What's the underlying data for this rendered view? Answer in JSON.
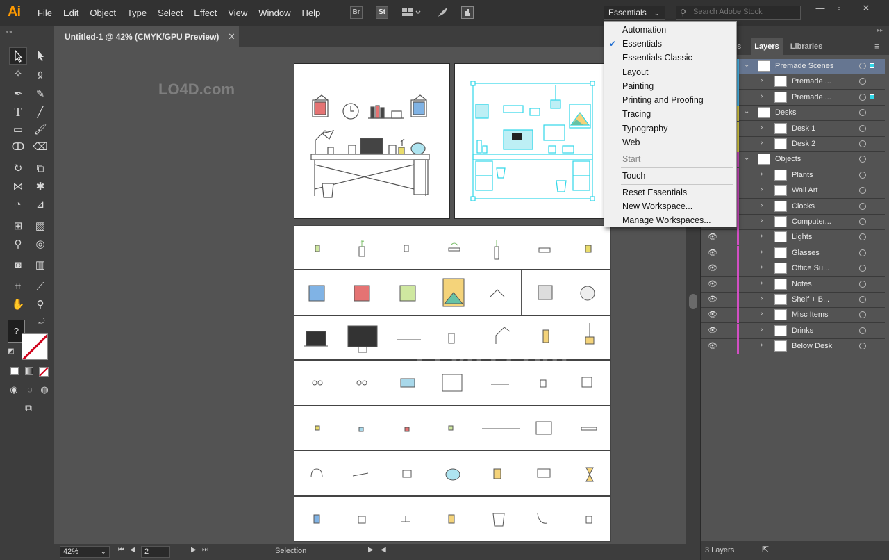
{
  "app": {
    "logo": "Ai"
  },
  "menubar": {
    "items": [
      "File",
      "Edit",
      "Object",
      "Type",
      "Select",
      "Effect",
      "View",
      "Window",
      "Help"
    ],
    "icons": {
      "bridge": "Br",
      "stock": "St"
    }
  },
  "workspace": {
    "current": "Essentials"
  },
  "search": {
    "placeholder": "Search Adobe Stock"
  },
  "document": {
    "tab_title": "Untitled-1 @ 42% (CMYK/GPU Preview)"
  },
  "status": {
    "zoom": "42%",
    "artboard": "2",
    "tool": "Selection"
  },
  "workspace_menu": {
    "items": [
      "Automation",
      "Essentials",
      "Essentials Classic",
      "Layout",
      "Painting",
      "Printing and Proofing",
      "Tracing",
      "Typography",
      "Web"
    ],
    "start_label": "Start",
    "touch_label": "Touch",
    "actions": [
      "Reset Essentials",
      "New Workspace...",
      "Manage Workspaces..."
    ]
  },
  "layers_panel": {
    "tabs": [
      "es",
      "Layers",
      "Libraries"
    ],
    "footer": "3 Layers",
    "rows": [
      {
        "name": "Premade Scenes",
        "color": "#4fc3f7"
      },
      {
        "name": "Premade ...",
        "color": "#4fc3f7"
      },
      {
        "name": "Premade ...",
        "color": "#4fc3f7"
      },
      {
        "name": "Desks",
        "color": "#e6d84a"
      },
      {
        "name": "Desk 1",
        "color": "#e6d84a"
      },
      {
        "name": "Desk 2",
        "color": "#e6d84a"
      },
      {
        "name": "Objects",
        "color": "#d24fc4"
      },
      {
        "name": "Plants",
        "color": "#d24fc4"
      },
      {
        "name": "Wall Art",
        "color": "#d24fc4"
      },
      {
        "name": "Clocks",
        "color": "#d24fc4"
      },
      {
        "name": "Computer...",
        "color": "#d24fc4"
      },
      {
        "name": "Lights",
        "color": "#d24fc4"
      },
      {
        "name": "Glasses",
        "color": "#d24fc4"
      },
      {
        "name": "Office Su...",
        "color": "#d24fc4"
      },
      {
        "name": "Notes",
        "color": "#d24fc4"
      },
      {
        "name": "Shelf + B...",
        "color": "#d24fc4"
      },
      {
        "name": "Misc Items",
        "color": "#d24fc4"
      },
      {
        "name": "Drinks",
        "color": "#d24fc4"
      },
      {
        "name": "Below Desk",
        "color": "#d24fc4"
      }
    ]
  },
  "watermark": {
    "text": "LO4D.com"
  },
  "colors": {
    "accent": "#ff9a00",
    "selection": "#31d7e8",
    "stroke_none": "#d0021b"
  }
}
